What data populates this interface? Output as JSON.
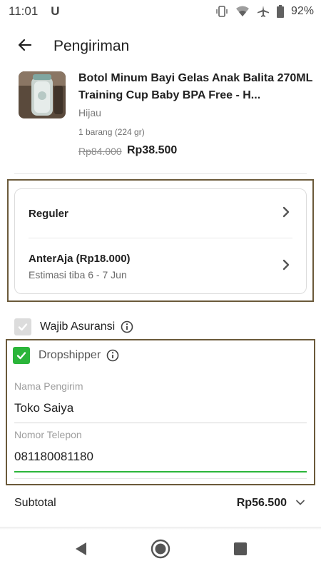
{
  "status_bar": {
    "time": "11:01",
    "carrier_icon": "U",
    "battery": "92%",
    "icons": [
      "vibrate-icon",
      "wifi-icon",
      "airplane-icon",
      "battery-icon"
    ]
  },
  "app_bar": {
    "title": "Pengiriman",
    "back_icon": "arrow-left-icon"
  },
  "product": {
    "name": "Botol Minum Bayi Gelas Anak Balita 270ML Training Cup Baby BPA Free - H...",
    "variant": "Hijau",
    "quantity": "1 barang (224 gr)",
    "price_original": "Rp84.000",
    "price_discounted": "Rp38.500"
  },
  "shipping": {
    "service": "Reguler",
    "courier": "AnterAja (Rp18.000)",
    "estimate": "Estimasi tiba 6 - 7 Jun"
  },
  "insurance": {
    "label": "Wajib Asuransi",
    "checked": true,
    "disabled": true
  },
  "dropshipper": {
    "label": "Dropshipper",
    "checked": true,
    "sender_name_label": "Nama Pengirim",
    "sender_name_value": "Toko Saiya",
    "phone_label": "Nomor Telepon",
    "phone_value": "081180081180"
  },
  "subtotal": {
    "label": "Subtotal",
    "value": "Rp56.500"
  },
  "colors": {
    "accent_green": "#2bb53a",
    "highlight_border": "#6b5a3a"
  }
}
